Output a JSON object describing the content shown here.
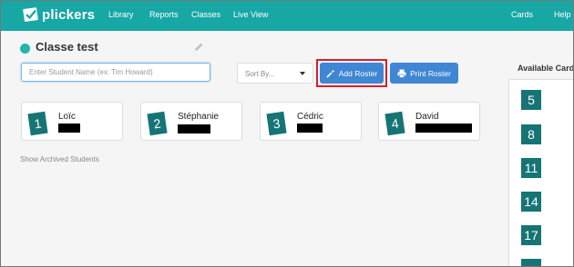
{
  "nav": {
    "logo": "plickers",
    "items": [
      "Library",
      "Reports",
      "Classes",
      "Live View"
    ],
    "right_items": [
      "Cards",
      "Help"
    ]
  },
  "class": {
    "title": "Classe test"
  },
  "toolbar": {
    "search_placeholder": "Enter Student Name (ex: Tim Howard)",
    "sort_label": "Sort By...",
    "add_roster_label": "Add Roster",
    "print_roster_label": "Print Roster"
  },
  "students": [
    {
      "number": "1",
      "name": "Loïc"
    },
    {
      "number": "2",
      "name": "Stéphanie"
    },
    {
      "number": "3",
      "name": "Cédric"
    },
    {
      "number": "4",
      "name": "David"
    }
  ],
  "show_archived_label": "Show Archived Students",
  "available_cards": {
    "title": "Available Cards",
    "numbers": [
      "5",
      "8",
      "11",
      "14",
      "17"
    ]
  },
  "colors": {
    "brand_teal": "#17a7a5",
    "card_teal": "#167475",
    "button_blue": "#3f86d4",
    "highlight_red": "#d81e2b"
  }
}
